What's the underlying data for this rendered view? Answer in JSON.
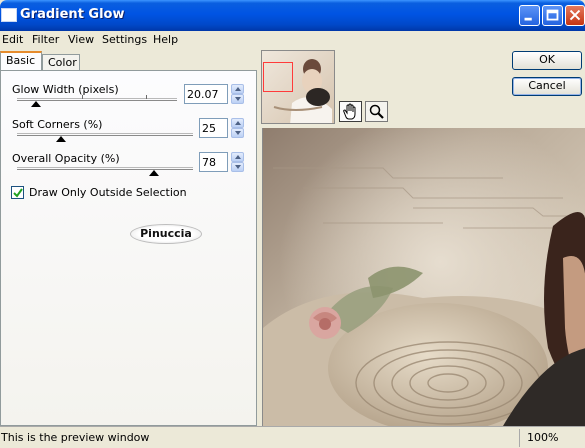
{
  "window": {
    "title": "Gradient Glow"
  },
  "menu": [
    "Edit",
    "Filter",
    "View",
    "Settings",
    "Help"
  ],
  "tabs": {
    "basic": "Basic",
    "color": "Color"
  },
  "params": [
    {
      "label": "Glow Width (pixels)",
      "value": "20.07"
    },
    {
      "label": "Soft Corners (%)",
      "value": "25"
    },
    {
      "label": "Overall Opacity (%)",
      "value": "78"
    }
  ],
  "slider_levels": {
    "glow_width_fraction": 0.12,
    "soft_corners_fraction": 0.25,
    "overall_opacity_fraction": 0.78
  },
  "checkbox": {
    "label": "Draw Only Outside Selection",
    "checked": true
  },
  "logo_text": "Pinuccia",
  "buttons": {
    "ok": "OK",
    "cancel": "Cancel"
  },
  "status": {
    "message": "This is the preview window",
    "zoom": "100%"
  },
  "colors": {
    "titlebar": "#0054e3",
    "window_bg": "#ece9d8",
    "tab_highlight": "#e68b2c",
    "selection_rect": "#ff3a3a"
  }
}
